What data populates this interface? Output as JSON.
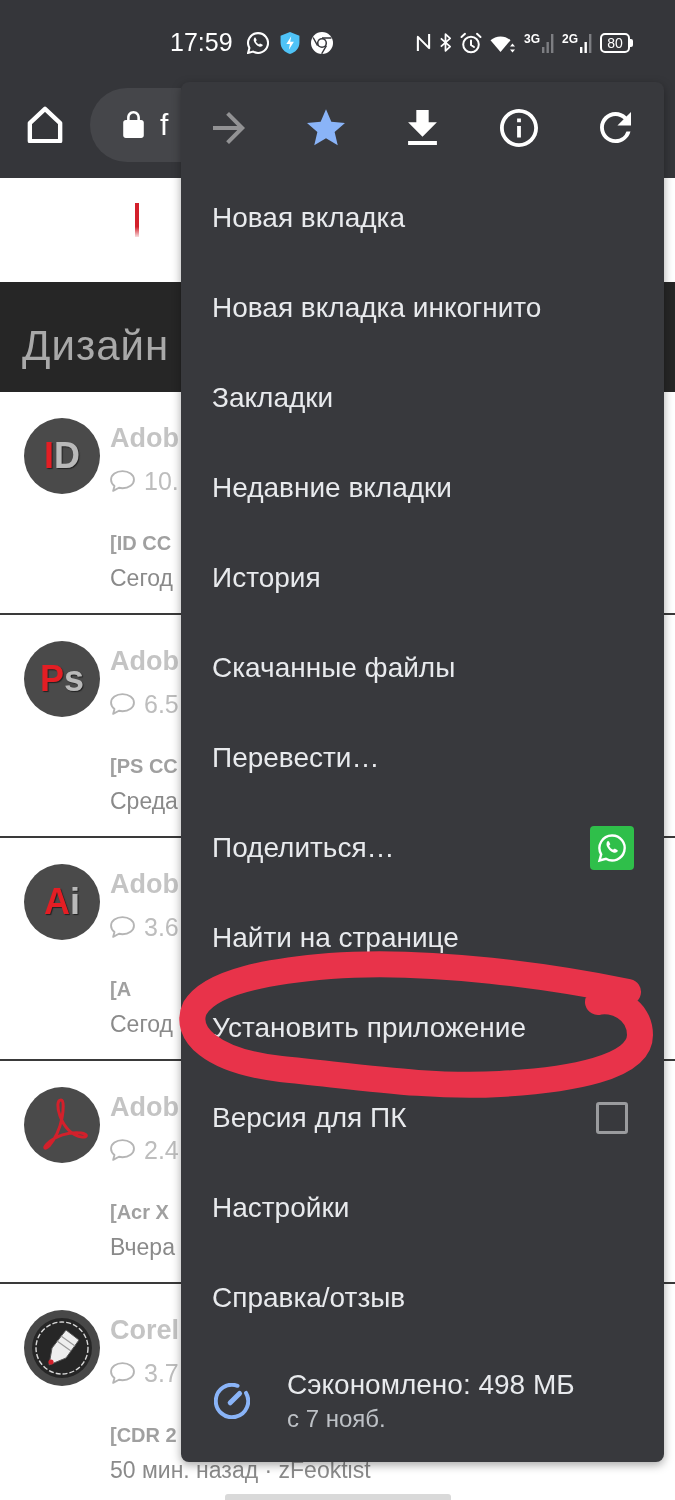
{
  "status_bar": {
    "time": "17:59",
    "networks": [
      {
        "label": "3G"
      },
      {
        "label": "2G"
      }
    ],
    "battery": "80"
  },
  "toolbar": {
    "url": "f"
  },
  "page": {
    "section_title": "Дизайн",
    "posts": [
      {
        "kind": "letters",
        "logo": {
          "accent": "I",
          "rest": "D"
        },
        "title": "Adob",
        "count": "10.",
        "tag": "[ID CC",
        "date": "Сегод"
      },
      {
        "kind": "letters",
        "logo": {
          "accent": "P",
          "rest": "s"
        },
        "title": "Adob",
        "count": "6.5",
        "tag": "[PS CC",
        "date": "Среда"
      },
      {
        "kind": "letters",
        "logo": {
          "accent": "A",
          "rest": "i"
        },
        "title": "Adob",
        "count": "3.6",
        "tag": "[A",
        "date": "Сегод"
      },
      {
        "kind": "swirl",
        "title": "Adob",
        "count": "2.4",
        "tag": "[Acr X",
        "date": "Вчера"
      },
      {
        "kind": "pen",
        "title": "Corel",
        "count": "3.7",
        "tag": "[CDR 2",
        "date": "50 мин. назад · zFeoktist"
      }
    ]
  },
  "menu": {
    "actions": [
      {
        "kind": "forward",
        "disabled": true,
        "on": false
      },
      {
        "kind": "bookmark",
        "disabled": false,
        "on": true
      },
      {
        "kind": "download",
        "disabled": false,
        "on": false
      },
      {
        "kind": "info",
        "disabled": false,
        "on": false
      },
      {
        "kind": "reload",
        "disabled": false,
        "on": false
      }
    ],
    "items": [
      {
        "kind": "plain",
        "label": "Новая вкладка",
        "circled": false
      },
      {
        "kind": "plain",
        "label": "Новая вкладка инкогнито",
        "circled": false
      },
      {
        "kind": "plain",
        "label": "Закладки",
        "circled": false
      },
      {
        "kind": "plain",
        "label": "Недавние вкладки",
        "circled": false
      },
      {
        "kind": "plain",
        "label": "История",
        "circled": false
      },
      {
        "kind": "plain",
        "label": "Скачанные файлы",
        "circled": false
      },
      {
        "kind": "plain",
        "label": "Перевести…",
        "circled": false
      },
      {
        "kind": "share",
        "label": "Поделиться…",
        "circled": false
      },
      {
        "kind": "plain",
        "label": "Найти на странице",
        "circled": false
      },
      {
        "kind": "plain",
        "label": "Установить приложение",
        "circled": true
      },
      {
        "kind": "checkbox",
        "label": "Версия для ПК",
        "checked": false,
        "circled": false
      },
      {
        "kind": "plain",
        "label": "Настройки",
        "circled": false
      },
      {
        "kind": "plain",
        "label": "Справка/отзыв",
        "circled": false
      }
    ],
    "data_saver": {
      "title": "Сэкономлено: 498 МБ",
      "subtitle": "с 7 нояб."
    }
  }
}
